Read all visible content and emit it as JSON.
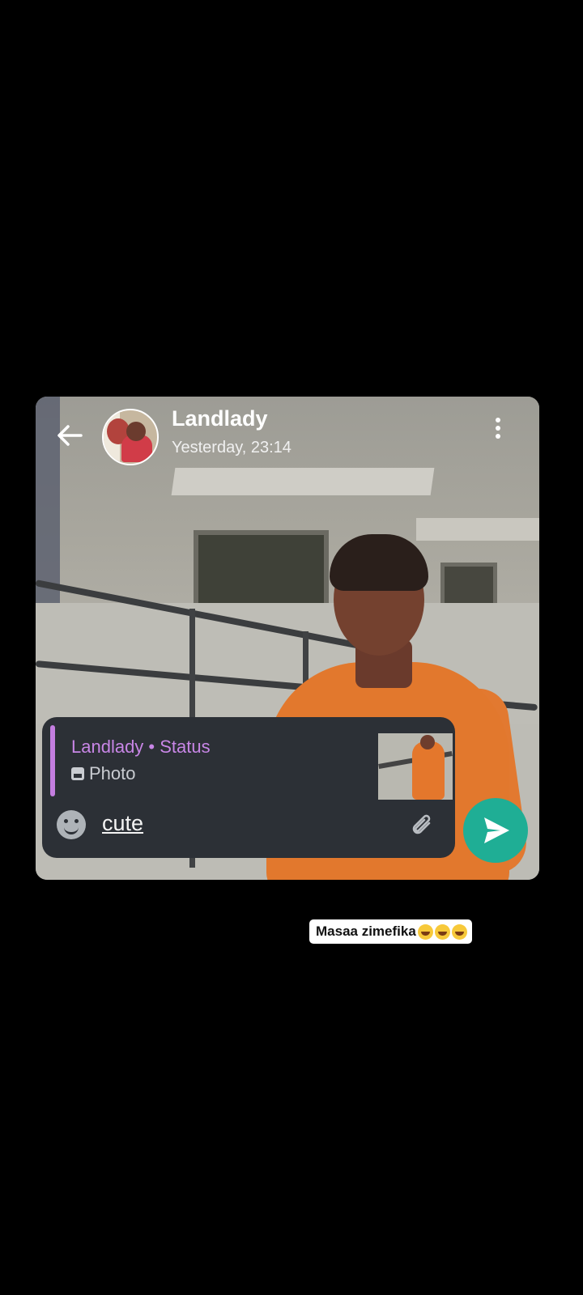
{
  "header": {
    "contact_name": "Landlady",
    "last_seen": "Yesterday, 23:14",
    "back_icon": "arrow-left-icon",
    "menu_icon": "more-vertical-icon"
  },
  "reply": {
    "quoted_title": "Landlady • Status",
    "quoted_type": "Photo",
    "quoted_icon": "photo-icon"
  },
  "composer": {
    "text": "cute",
    "emoji_icon": "emoji-icon",
    "attach_icon": "paperclip-icon",
    "send_icon": "send-icon"
  },
  "caption": {
    "text": "Masaa zimefika",
    "emoji": "laughing-emoji"
  },
  "colors": {
    "accent_green": "#1fae95",
    "quote_purple": "#c47ee0",
    "composer_bg": "#2c3036"
  }
}
